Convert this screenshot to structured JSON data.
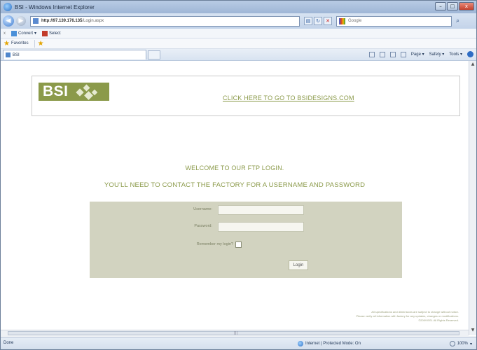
{
  "window": {
    "title": "BSI - Windows Internet Explorer",
    "controls": {
      "minimize": "–",
      "maximize": "□",
      "close": "x"
    }
  },
  "addressbar": {
    "url_host": "http://97.139.176.135",
    "url_path": "/Login.aspx",
    "search_placeholder": "Google"
  },
  "commandbar": {
    "close": "x",
    "items": [
      "Convert",
      "Select"
    ]
  },
  "favorites": {
    "label": "Favorites"
  },
  "tab": {
    "title": "BSI"
  },
  "tools": {
    "page": "Page",
    "safety": "Safety",
    "tools": "Tools"
  },
  "page": {
    "logo_text": "BSI",
    "site_link": "CLICK HERE TO GO TO BSIDESIGNS.COM",
    "welcome_line1": "WELCOME TO OUR FTP LOGIN.",
    "welcome_line2": "YOU'LL NEED TO CONTACT THE FACTORY FOR A USERNAME AND PASSWORD",
    "username_label": "Username:",
    "password_label": "Password:",
    "remember_label": "Remember my login?",
    "login_button": "Login",
    "legal_line1": "All specifications and dimensions are subject to change without notice.",
    "legal_line2": "Please verify all information with factory for any updates, changes or modifications.",
    "legal_line3": "©2009 BSI. All Rights Reserved."
  },
  "statusbar": {
    "status": "Done",
    "zone": "Internet | Protected Mode: On",
    "zoom": "100%"
  },
  "colors": {
    "brand_olive": "#8b9a4a",
    "login_panel": "#d2d3c0"
  }
}
